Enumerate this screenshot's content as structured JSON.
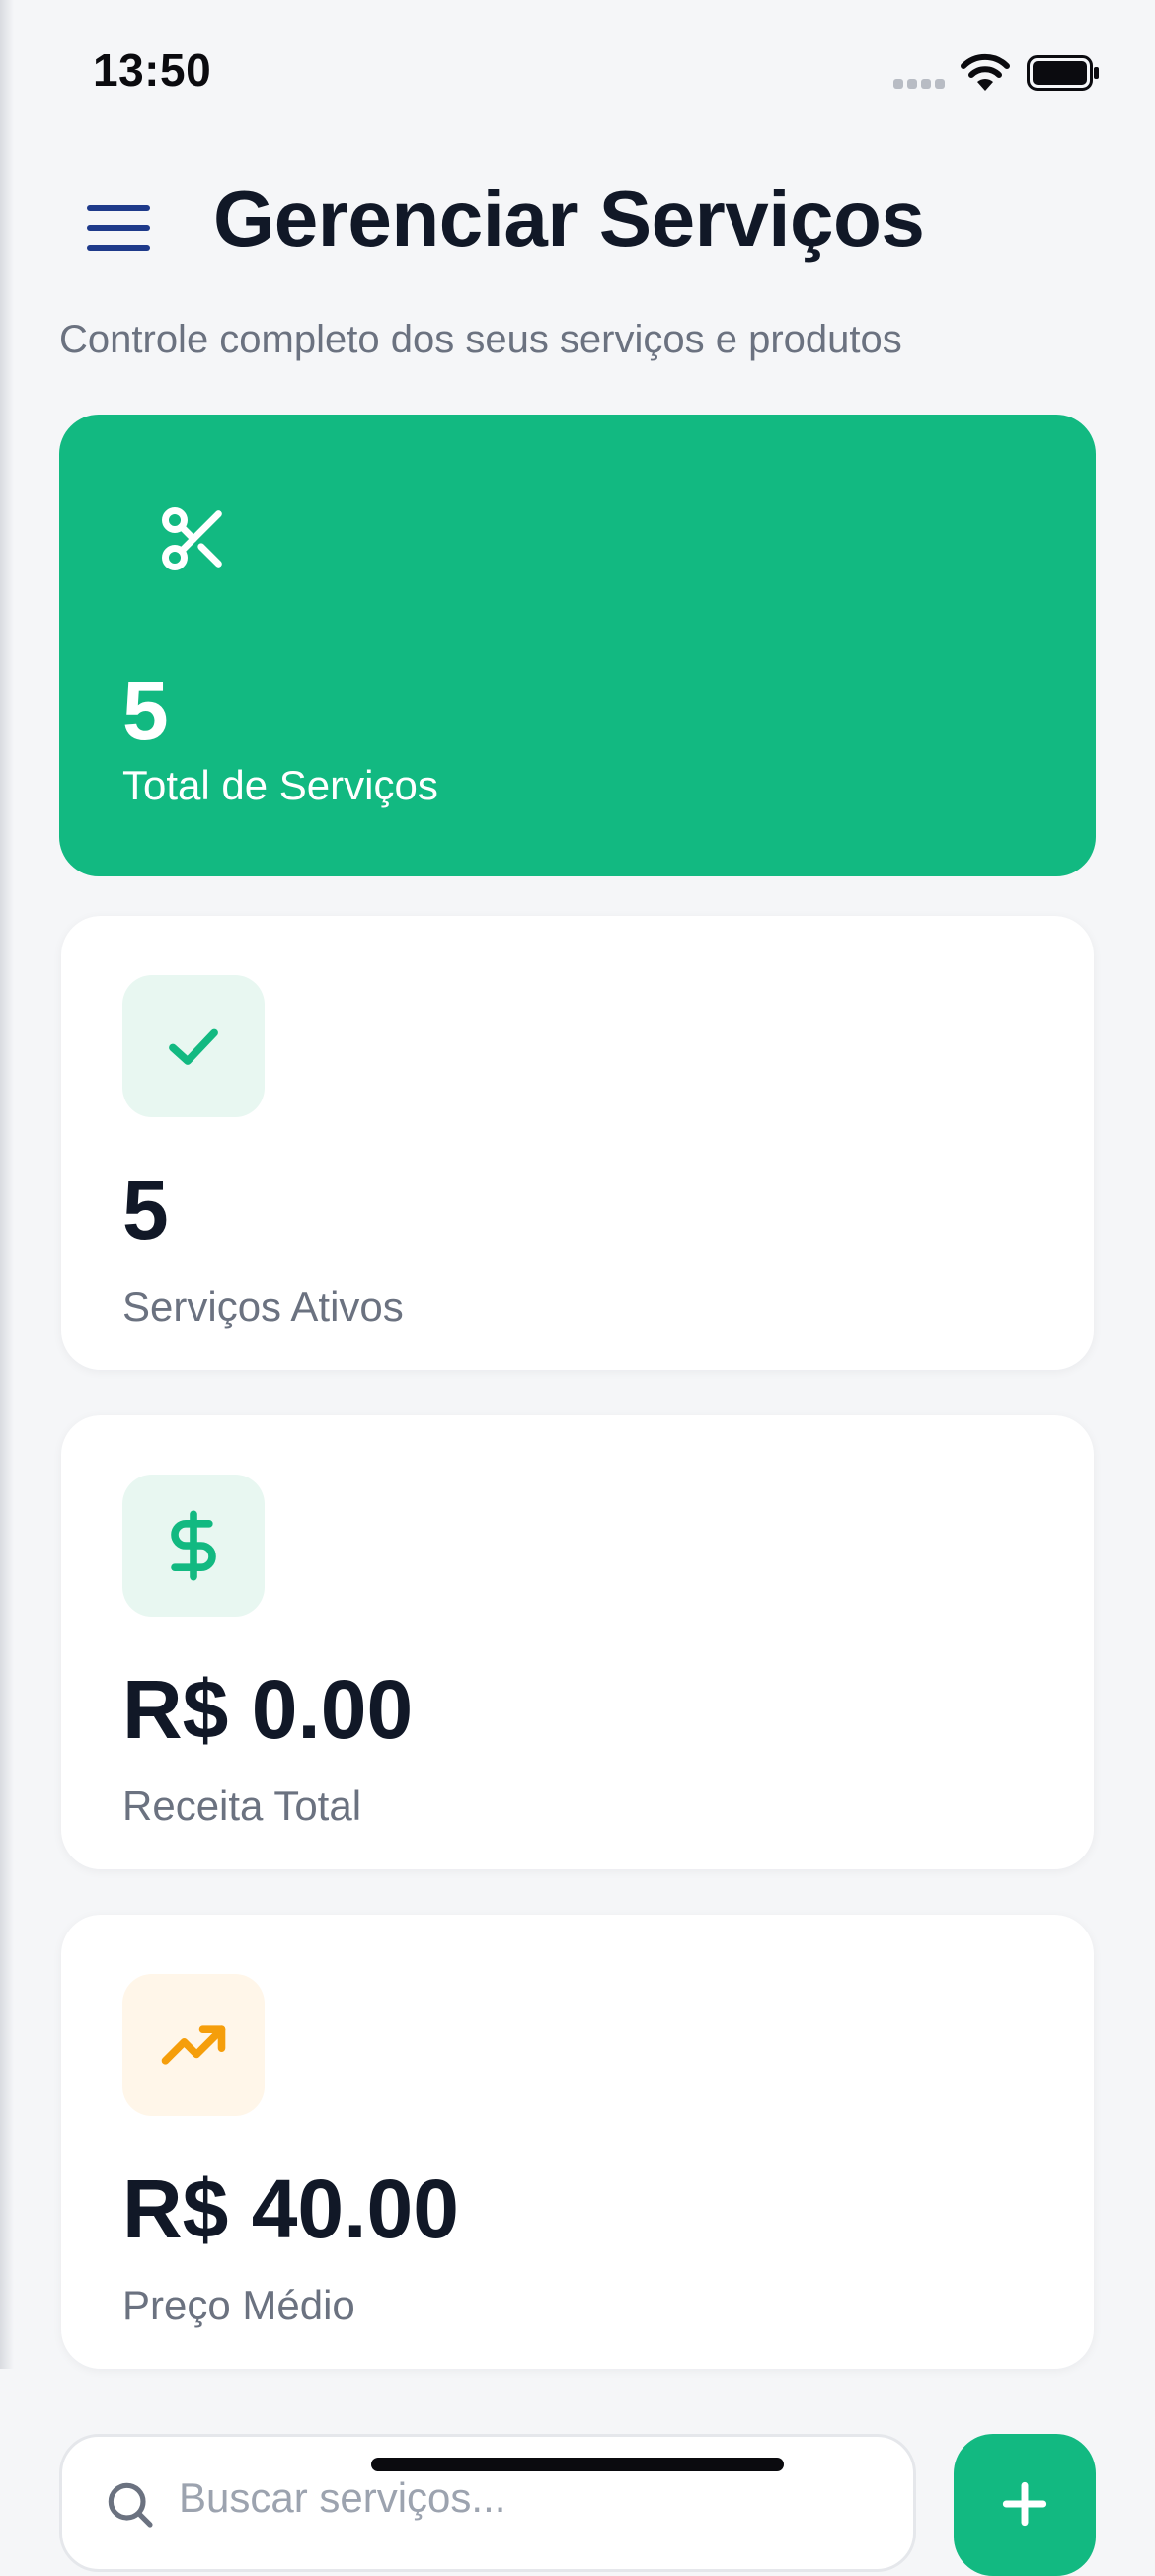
{
  "status_bar": {
    "time": "13:50"
  },
  "header": {
    "menu_icon": "hamburger-menu-icon",
    "title": "Gerenciar Serviços",
    "subtitle": "Controle completo dos seus serviços e produtos"
  },
  "stats": [
    {
      "icon": "scissors-icon",
      "value": "5",
      "label": "Total de Serviços",
      "accent": "#12b981"
    },
    {
      "icon": "check-icon",
      "value": "5",
      "label": "Serviços Ativos",
      "accent": "#12b981"
    },
    {
      "icon": "dollar-icon",
      "value": "R$ 0.00",
      "label": "Receita Total",
      "accent": "#12b981"
    },
    {
      "icon": "trending-up-icon",
      "value": "R$ 40.00",
      "label": "Preço Médio",
      "accent": "#f59e0b"
    }
  ],
  "search": {
    "placeholder": "Buscar serviços..."
  },
  "colors": {
    "primary": "#12b981",
    "text": "#111827",
    "muted": "#6b7280",
    "background": "#f5f6f8",
    "menu_icon": "#1e3a8a",
    "warning": "#f59e0b"
  }
}
